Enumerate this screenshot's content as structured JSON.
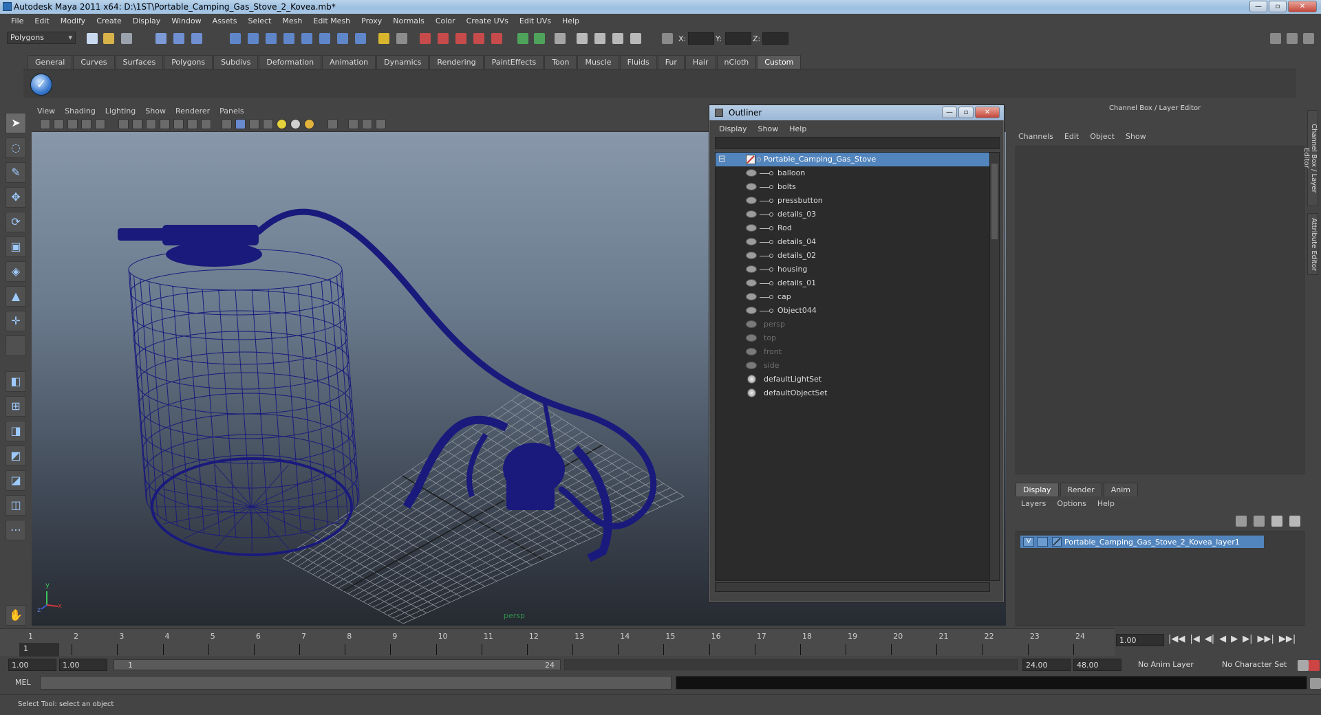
{
  "window": {
    "title": "Autodesk Maya 2011 x64: D:\\1ST\\Portable_Camping_Gas_Stove_2_Kovea.mb*",
    "buttons": [
      "—",
      "▫",
      "✕"
    ]
  },
  "menubar": [
    "File",
    "Edit",
    "Modify",
    "Create",
    "Display",
    "Window",
    "Assets",
    "Select",
    "Mesh",
    "Edit Mesh",
    "Proxy",
    "Normals",
    "Color",
    "Create UVs",
    "Edit UVs",
    "Help"
  ],
  "status": {
    "mode": "Polygons",
    "x_label": "X:",
    "y_label": "Y:",
    "z_label": "Z:"
  },
  "shelf": {
    "tabs": [
      "General",
      "Curves",
      "Surfaces",
      "Polygons",
      "Subdivs",
      "Deformation",
      "Animation",
      "Dynamics",
      "Rendering",
      "PaintEffects",
      "Toon",
      "Muscle",
      "Fluids",
      "Fur",
      "Hair",
      "nCloth",
      "Custom"
    ],
    "active": "Custom",
    "button_glyph": "✓"
  },
  "viewport": {
    "menu": [
      "View",
      "Shading",
      "Lighting",
      "Show",
      "Renderer",
      "Panels"
    ],
    "camera_label": "persp",
    "axis_y": "y",
    "axis_x": "x",
    "axis_z": "z",
    "wire_color": "#1a1a7c"
  },
  "outliner": {
    "title": "Outliner",
    "menu": [
      "Display",
      "Show",
      "Help"
    ],
    "collapse_glyph": "⊟",
    "root": "Portable_Camping_Gas_Stove",
    "children": [
      "balloon",
      "bolts",
      "pressbutton",
      "details_03",
      "Rod",
      "details_04",
      "details_02",
      "housing",
      "details_01",
      "cap",
      "Object044"
    ],
    "cameras": [
      "persp",
      "top",
      "front",
      "side"
    ],
    "sets": [
      "defaultLightSet",
      "defaultObjectSet"
    ],
    "select_color": "#5285bd"
  },
  "channelbox": {
    "title": "Channel Box / Layer Editor",
    "menu": [
      "Channels",
      "Edit",
      "Object",
      "Show"
    ]
  },
  "sidetabs": [
    "Channel Box / Layer Editor",
    "Attribute Editor"
  ],
  "layereditor": {
    "tabs": [
      "Display",
      "Render",
      "Anim"
    ],
    "active": "Display",
    "menu": [
      "Layers",
      "Options",
      "Help"
    ],
    "layer": {
      "visible_flag": "V",
      "name": "Portable_Camping_Gas_Stove_2_Kovea_layer1"
    }
  },
  "timeline": {
    "ticks": [
      "1",
      "2",
      "3",
      "4",
      "5",
      "6",
      "7",
      "8",
      "9",
      "10",
      "11",
      "12",
      "13",
      "14",
      "15",
      "16",
      "17",
      "18",
      "19",
      "20",
      "21",
      "22",
      "23",
      "24"
    ],
    "current_frame": "1.00",
    "playhead_label": "1"
  },
  "playback": {
    "controls": [
      "|◀◀",
      "|◀",
      "◀|",
      "◀",
      "▶",
      "▶|",
      "▶▶|",
      "▶▶|"
    ]
  },
  "range": {
    "start_time": "1.00",
    "playback_start": "1.00",
    "slider_start": "1",
    "slider_end": "24",
    "playback_end": "24.00",
    "end_time": "48.00",
    "anim_layer": "No Anim Layer",
    "char_set": "No Character Set"
  },
  "cmdline": {
    "label": "MEL"
  },
  "helpline": {
    "text": "Select Tool: select an object"
  }
}
